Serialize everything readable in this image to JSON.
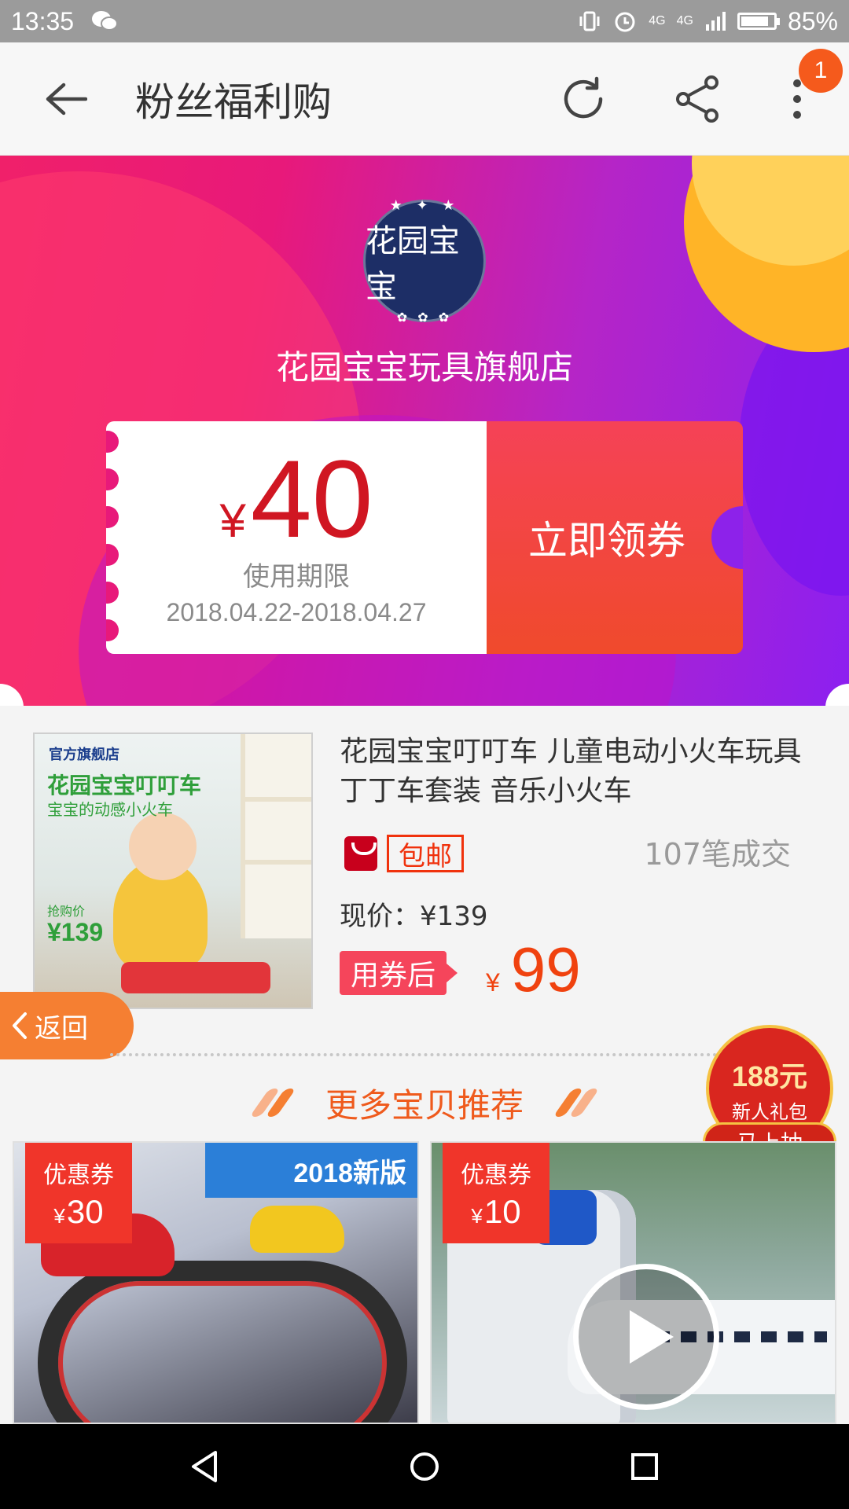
{
  "status_bar": {
    "time": "13:35",
    "battery_percent": "85%",
    "battery_level": 0.85,
    "network_1": "4G",
    "network_2": "4G"
  },
  "app_bar": {
    "title": "粉丝福利购",
    "notification_count": "1"
  },
  "shop": {
    "logo_text": "花园宝宝",
    "name": "花园宝宝玩具旗舰店"
  },
  "coupon": {
    "currency": "¥",
    "amount": "40",
    "validity_label": "使用期限",
    "validity_range": "2018.04.22-2018.04.27",
    "claim_label": "立即领券"
  },
  "product": {
    "image_tag": "官方旗舰店",
    "image_title": "花园宝宝叮叮车",
    "image_subtitle": "宝宝的动感小火车",
    "image_price_label": "抢购价",
    "image_price": "¥139",
    "title": "花园宝宝叮叮车 儿童电动小火车玩具丁丁车套装 音乐小火车",
    "free_shipping": "包邮",
    "sales": "107笔成交",
    "current_price": "现价：¥139",
    "after_coupon_label": "用券后",
    "final_currency": "¥",
    "final_price": "99"
  },
  "back_float_label": "返回",
  "more_section": {
    "title": "更多宝贝推荐"
  },
  "gift": {
    "amount": "188元",
    "subtitle": "新人礼包",
    "button": "马上抽"
  },
  "recommendations": [
    {
      "coupon_label": "优惠券",
      "currency": "¥",
      "coupon_value": "30",
      "banner": "2018新版"
    },
    {
      "coupon_label": "优惠券",
      "currency": "¥",
      "coupon_value": "10"
    }
  ],
  "colors": {
    "accent_orange": "#f57f32",
    "price_red": "#d01622",
    "coupon_red": "#f54257",
    "hero_pink": "#f0206a",
    "hero_purple": "#8c1ff0"
  },
  "icons": [
    "back-arrow-icon",
    "refresh-icon",
    "share-icon",
    "more-vert-icon",
    "vibrate-icon",
    "alarm-icon",
    "signal-icon",
    "battery-icon",
    "wechat-icon",
    "tmall-icon",
    "play-icon",
    "nav-back-icon",
    "nav-home-icon",
    "nav-recents-icon"
  ]
}
